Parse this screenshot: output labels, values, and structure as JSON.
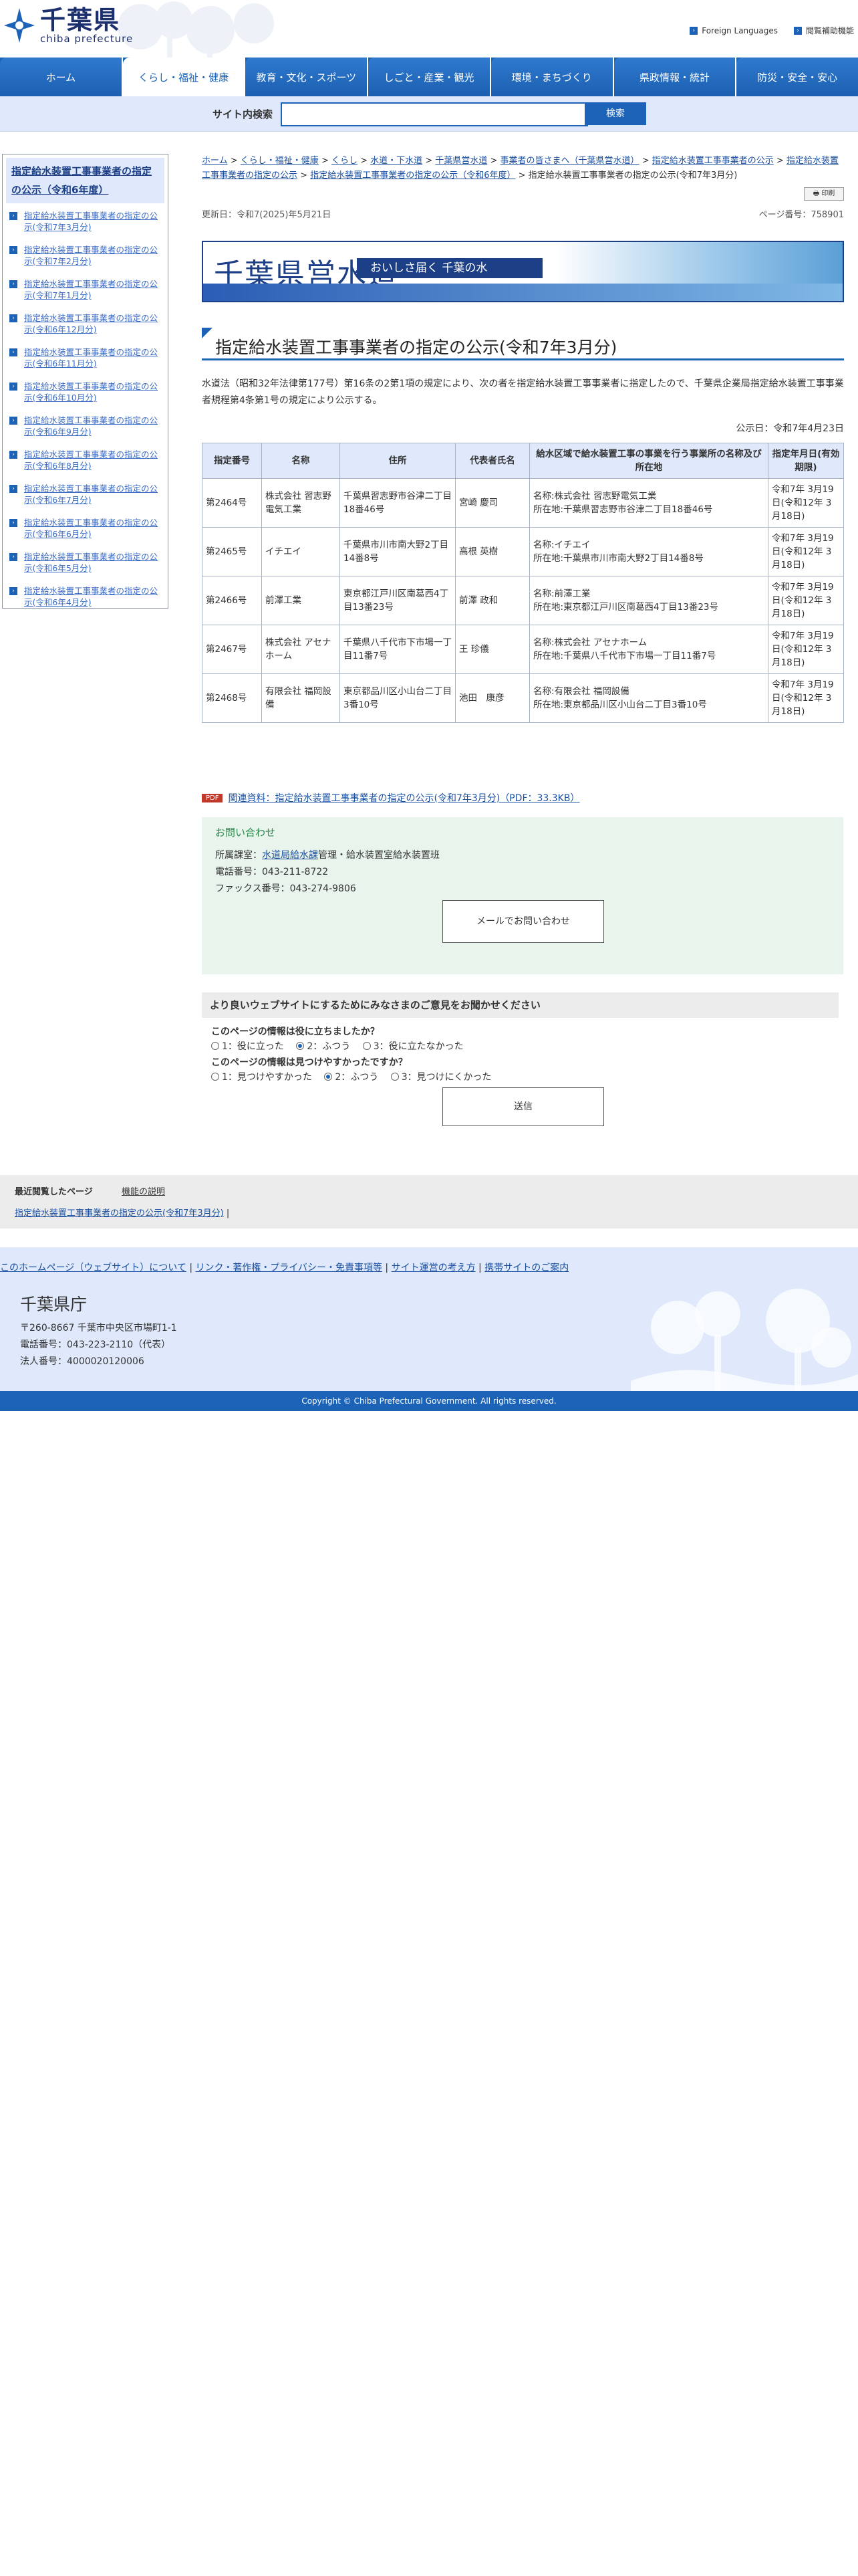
{
  "header": {
    "logo_ja": "千葉県",
    "logo_en": "chiba prefecture",
    "links": [
      {
        "label": "Foreign Languages"
      },
      {
        "label": "閲覧補助機能"
      }
    ]
  },
  "nav": [
    {
      "label": "ホーム",
      "active": false
    },
    {
      "label": "くらし・福祉・健康",
      "active": true
    },
    {
      "label": "教育・文化・スポーツ",
      "active": false
    },
    {
      "label": "しごと・産業・観光",
      "active": false
    },
    {
      "label": "環境・まちづくり",
      "active": false
    },
    {
      "label": "県政情報・統計",
      "active": false
    },
    {
      "label": "防災・安全・安心",
      "active": false
    }
  ],
  "search": {
    "label": "サイト内検索",
    "button": "検索",
    "placeholder": ""
  },
  "sidebar": {
    "title": "指定給水装置工事事業者の指定の公示（令和6年度）",
    "items": [
      "指定給水装置工事事業者の指定の公示(令和7年3月分)",
      "指定給水装置工事事業者の指定の公示(令和7年2月分)",
      "指定給水装置工事事業者の指定の公示(令和7年1月分)",
      "指定給水装置工事事業者の指定の公示(令和6年12月分)",
      "指定給水装置工事事業者の指定の公示(令和6年11月分)",
      "指定給水装置工事事業者の指定の公示(令和6年10月分)",
      "指定給水装置工事事業者の指定の公示(令和6年9月分)",
      "指定給水装置工事事業者の指定の公示(令和6年8月分)",
      "指定給水装置工事事業者の指定の公示(令和6年7月分)",
      "指定給水装置工事事業者の指定の公示(令和6年6月分)",
      "指定給水装置工事事業者の指定の公示(令和6年5月分)",
      "指定給水装置工事事業者の指定の公示(令和6年4月分)"
    ]
  },
  "breadcrumb": [
    "ホーム",
    "くらし・福祉・健康",
    "くらし",
    "水道・下水道",
    "千葉県営水道",
    "事業者の皆さまへ（千葉県営水道）",
    "指定給水装置工事事業者の公示",
    "指定給水装置工事事業者の指定の公示",
    "指定給水装置工事事業者の指定の公示（令和6年度）"
  ],
  "breadcrumb_current": "指定給水装置工事事業者の指定の公示(令和7年3月分)",
  "print_label": "印刷",
  "meta": {
    "updated": "更新日：令和7(2025)年5月21日",
    "page_no": "ページ番号：758901"
  },
  "banner": {
    "title": "千葉県営水道",
    "subtitle": "おいしさ届く 千葉の水"
  },
  "page_title": "指定給水装置工事事業者の指定の公示(令和7年3月分)",
  "body_text": "水道法（昭和32年法律第177号）第16条の2第1項の規定により、次の者を指定給水装置工事事業者に指定したので、千葉県企業局指定給水装置工事事業者規程第4条第1号の規定により公示する。",
  "publish_date": "公示日：令和7年4月23日",
  "table": {
    "headers": [
      "指定番号",
      "名称",
      "住所",
      "代表者氏名",
      "給水区域で給水装置工事の事業を行う事業所の名称及び所在地",
      "指定年月日(有効期限)"
    ],
    "rows": [
      [
        "第2464号",
        "株式会社 習志野電気工業",
        "千葉県習志野市谷津二丁目18番46号",
        "宮崎 慶司",
        "名称:株式会社 習志野電気工業\n所在地:千葉県習志野市谷津二丁目18番46号",
        "令和7年 3月19日(令和12年 3月18日)"
      ],
      [
        "第2465号",
        "イチエイ",
        "千葉県市川市南大野2丁目14番8号",
        "高根 英樹",
        "名称:イチエイ\n所在地:千葉県市川市南大野2丁目14番8号",
        "令和7年 3月19日(令和12年 3月18日)"
      ],
      [
        "第2466号",
        "前澤工業",
        "東京都江戸川区南葛西4丁目13番23号",
        "前澤 政和",
        "名称:前澤工業\n所在地:東京都江戸川区南葛西4丁目13番23号",
        "令和7年 3月19日(令和12年 3月18日)"
      ],
      [
        "第2467号",
        "株式会社 アセナホーム",
        "千葉県八千代市下市場一丁目11番7号",
        "王 珍儀",
        "名称:株式会社 アセナホーム\n所在地:千葉県八千代市下市場一丁目11番7号",
        "令和7年 3月19日(令和12年 3月18日)"
      ],
      [
        "第2468号",
        "有限会社 福岡設備",
        "東京都品川区小山台二丁目3番10号",
        "池田　康彦",
        "名称:有限会社 福岡設備\n所在地:東京都品川区小山台二丁目3番10号",
        "令和7年 3月19日(令和12年 3月18日)"
      ]
    ]
  },
  "related": {
    "badge": "PDF",
    "link": "関連資料：指定給水装置工事事業者の指定の公示(令和7年3月分)（PDF：33.3KB）"
  },
  "contact": {
    "title": "お問い合わせ",
    "dept_prefix": "所属課室：",
    "dept_link": "水道局給水課",
    "dept_suffix": "管理・給水装置室給水装置班",
    "phone": "電話番号：043-211-8722",
    "fax": "ファックス番号：043-274-9806",
    "mail_button": "メールでお問い合わせ"
  },
  "survey": {
    "heading": "より良いウェブサイトにするためにみなさまのご意見をお聞かせください",
    "q1": "このページの情報は役に立ちましたか？",
    "q1_options": [
      "1：役に立った",
      "2：ふつう",
      "3：役に立たなかった"
    ],
    "q1_selected": 1,
    "q2": "このページの情報は見つけやすかったですか？",
    "q2_options": [
      "1：見つけやすかった",
      "2：ふつう",
      "3：見つけにくかった"
    ],
    "q2_selected": 1,
    "submit": "送信"
  },
  "recent": {
    "heading": "最近閲覧したページ",
    "help": "機能の説明",
    "link": "指定給水装置工事事業者の指定の公示(令和7年3月分)"
  },
  "footer": {
    "links": [
      "このホームページ（ウェブサイト）について",
      "リンク・著作権・プライバシー・免責事項等",
      "サイト運営の考え方",
      "携帯サイトのご案内"
    ],
    "org": "千葉県庁",
    "address": "〒260-8667 千葉市中央区市場町1-1",
    "phone": "電話番号：043-223-2110（代表）",
    "corp_no": "法人番号：4000020120006",
    "copyright": "Copyright © Chiba Prefectural Government. All rights reserved."
  },
  "colors": {
    "brand": "#1c63b8",
    "nav_bg": "#1c63b8",
    "light_bg": "#dfe9fb",
    "contact_bg": "#e8f4ec"
  }
}
